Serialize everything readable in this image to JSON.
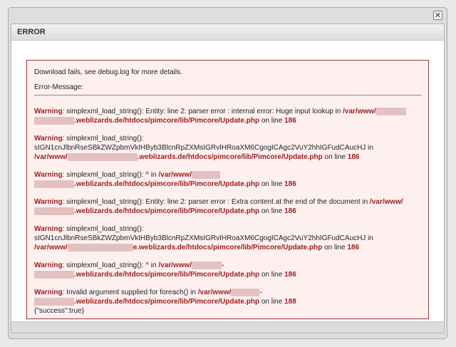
{
  "window": {
    "close_glyph": "✕"
  },
  "panel": {
    "title": "ERROR"
  },
  "error": {
    "intro": "Download fails, see debug.log for more details.",
    "label": "Error-Message:",
    "messages": [
      {
        "prefix": "Warning",
        "text": ": simplexml_load_string(): Entity: line 2: parser error : internal error: Huge input lookup in ",
        "path_start": "/var/www/",
        "path_end": ".weblizards.de/htdocs/pimcore/lib/Pimcore/Update.php",
        "on_line": " on line ",
        "line": "186"
      },
      {
        "prefix": "Warning",
        "text": ": simplexml_load_string(): sIGN1cnJlbnRseSBkZWZpbmVkIHByb3BlcnRpZXMsIGRvIHRoaXM6CgogICAgc2VuY2hhIGFudCAucHJ in ",
        "path_start": "/var/www/",
        "path_end": ".weblizards.de/htdocs/pimcore/lib/Pimcore/Update.php",
        "on_line": " on line ",
        "line": "186"
      },
      {
        "prefix": "Warning",
        "text": ": simplexml_load_string(): ^ in ",
        "path_start": "/var/www/",
        "path_end": ".weblizards.de/htdocs/pimcore/lib/Pimcore/Update.php",
        "on_line": " on line ",
        "line": "186"
      },
      {
        "prefix": "Warning",
        "text": ": simplexml_load_string(): Entity: line 2: parser error : Extra content at the end of the document in ",
        "path_start": "/var/www/",
        "path_end": ".weblizards.de/htdocs/pimcore/lib/Pimcore/Update.php",
        "on_line": " on line ",
        "line": "186"
      },
      {
        "prefix": "Warning",
        "text": ": simplexml_load_string(): sIGN1cnJlbnRseSBkZWZpbmVkIHByb3BlcnRpZXMsIGRvIHRoaXM6CgogICAgc2VuY2hhIGFudCAucHJ in ",
        "path_start": "/var/www/",
        "path_end": "e.weblizards.de/htdocs/pimcore/lib/Pimcore/Update.php",
        "on_line": " on line ",
        "line": "186"
      },
      {
        "prefix": "Warning",
        "text": ": simplexml_load_string(): ^ in ",
        "path_start": "/var/www/",
        "path_end": ".weblizards.de/htdocs/pimcore/lib/Pimcore/Update.php",
        "on_line": " on line ",
        "line": "186"
      },
      {
        "prefix": "Warning",
        "text": ": Invalid argument supplied for foreach() in ",
        "path_start": "/var/www/",
        "path_end": ".weblizards.de/htdocs/pimcore/lib/Pimcore/Update.php",
        "on_line": " on line ",
        "line": "188"
      }
    ],
    "result": "{\"success\":true}"
  }
}
